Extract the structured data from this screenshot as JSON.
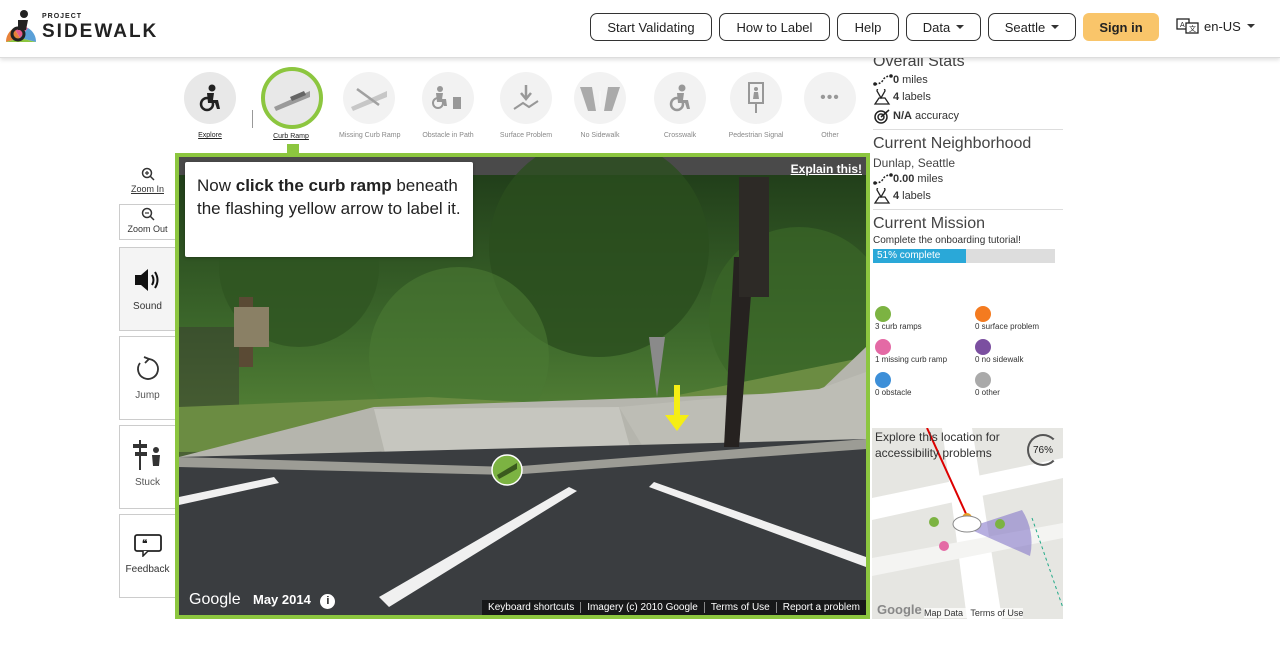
{
  "header": {
    "logo_small": "PROJECT",
    "logo_big": "SIDEWALK",
    "nav": {
      "start_validating": "Start Validating",
      "how_to_label": "How to Label",
      "help": "Help",
      "data": "Data",
      "city": "Seattle",
      "sign_in": "Sign in",
      "language": "en-US"
    }
  },
  "tools": [
    {
      "label": "Explore"
    },
    {
      "label": "Curb Ramp"
    },
    {
      "label": "Missing Curb Ramp"
    },
    {
      "label": "Obstacle in Path"
    },
    {
      "label": "Surface Problem"
    },
    {
      "label": "No Sidewalk"
    },
    {
      "label": "Crosswalk"
    },
    {
      "label": "Pedestrian Signal"
    },
    {
      "label": "Other"
    }
  ],
  "controls": {
    "zoom_in": "Zoom In",
    "zoom_out": "Zoom Out",
    "sound": "Sound",
    "jump": "Jump",
    "stuck": "Stuck",
    "feedback": "Feedback"
  },
  "streetview": {
    "tooltip_prefix": "Now ",
    "tooltip_bold": "click the curb ramp",
    "tooltip_suffix": " beneath the flashing yellow arrow to label it.",
    "explain": "Explain this!",
    "google": "Google",
    "date": "May 2014",
    "footer": [
      "Keyboard shortcuts",
      "Imagery (c) 2010 Google",
      "Terms of Use",
      "Report a problem"
    ]
  },
  "stats": {
    "overall_title": "Overall Stats",
    "overall_miles_value": "0",
    "overall_miles_unit": "miles",
    "overall_labels_value": "4",
    "overall_labels_unit": "labels",
    "accuracy_value": "N/A",
    "accuracy_unit": "accuracy",
    "neighborhood_title": "Current Neighborhood",
    "neighborhood_name": "Dunlap, Seattle",
    "neighborhood_miles_value": "0.00",
    "neighborhood_miles_unit": "miles",
    "neighborhood_labels_value": "4",
    "neighborhood_labels_unit": "labels",
    "mission_title": "Current Mission",
    "mission_desc": "Complete the onboarding tutorial!",
    "mission_progress_text": "51% complete",
    "mission_progress": 0.51
  },
  "legend": [
    {
      "text": "3 curb ramps",
      "color": "#7cb342"
    },
    {
      "text": "0 surface problem",
      "color": "#f47b20"
    },
    {
      "text": "1 missing curb ramp",
      "color": "#e46aa5"
    },
    {
      "text": "0 no sidewalk",
      "color": "#7b4fa0"
    },
    {
      "text": "0 obstacle",
      "color": "#3d8fd8"
    },
    {
      "text": "0 other",
      "color": "#aaaaaa"
    }
  ],
  "minimap": {
    "text": "Explore this location for accessibility problems",
    "percent": "76%",
    "map_data": "Map Data",
    "terms": "Terms of Use",
    "google": "Google"
  },
  "colors": {
    "accent_green": "#8cc63f",
    "signin": "#f9c56a",
    "progress": "#2aa8d8"
  }
}
